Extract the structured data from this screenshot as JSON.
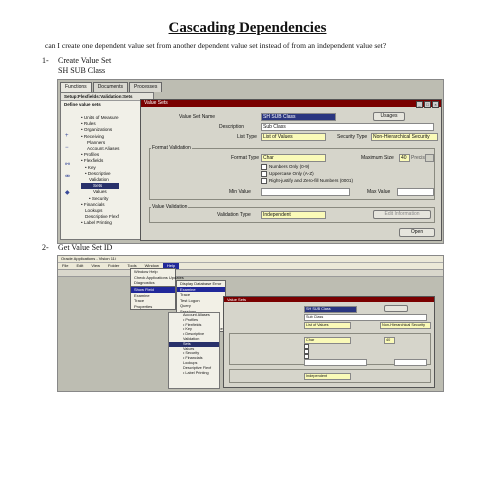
{
  "title": "Cascading Dependencies",
  "question": "can I create one dependent value set from another dependent value set instead of from an independent value set?",
  "step1": {
    "num": "1-",
    "line1": "Create Value Set",
    "line2": "SH SUB Class"
  },
  "step2": {
    "num": "2-",
    "text": "Get Value Set ID"
  },
  "screenshot1": {
    "tabs": [
      "Functions",
      "Documents",
      "Processes"
    ],
    "nav_header": "Setup:Flexfields:Validation:Sets",
    "nav_subheader": "Define value sets",
    "tree": [
      "• Units of Measure",
      "• Rules",
      "• Organizations",
      "• Receiving",
      "Planners",
      "Account Aliases",
      "• Profiles",
      "• Flexfields",
      "• Key",
      "• Descriptive",
      "Validation",
      "Sets",
      "Values",
      "• Security",
      "• Financials",
      "Lookups",
      "Descriptive Flexf",
      "• Label Printing"
    ],
    "window_title": "Value Sets",
    "value_set_name_label": "Value Set Name",
    "value_set_name": "SH SUB Class",
    "usages_button": "Usages",
    "description_label": "Description",
    "description": "Sub Class",
    "list_type_label": "List Type",
    "list_type": "List of Values",
    "security_type_label": "Security Type",
    "security_type": "Non-Hierarchical Security",
    "format_validation": "Format Validation",
    "format_type_label": "Format Type",
    "format_type": "Char",
    "maximum_size_label": "Maximum Size",
    "maximum_size": "40",
    "precision_label": "Precision",
    "checkboxes": [
      "Numbers Only (0-9)",
      "Uppercase Only (A-Z)",
      "Right-justify and Zero-fill Numbers (0001)"
    ],
    "min_value_label": "Min Value",
    "max_value_label": "Max Value",
    "value_validation": "Value Validation",
    "validation_type_label": "Validation Type",
    "validation_type": "Independent",
    "edit_information_button": "Edit Information",
    "open_button": "Open"
  },
  "screenshot2": {
    "app_title": "Oracle Applications - Vision 11i",
    "menu": [
      "File",
      "Edit",
      "View",
      "Folder",
      "Tools",
      "Window",
      "Help"
    ],
    "menu_left": [
      "Window Help",
      "Check Applications Updates",
      "Diagnostics"
    ],
    "diagnostics_menu": [
      "Show Field",
      "Examine",
      "Trace",
      "Properties"
    ],
    "examine_menu": [
      "Display Database Error",
      "Examine",
      "Trace",
      "Test Logon",
      "Query",
      "Sessions",
      "Properties",
      "Custom Code",
      "Check Available Services"
    ],
    "tree": [
      "Account Aliases",
      "• Profiles",
      "• Flexfields",
      "• Key",
      "• Descriptive",
      "Validation",
      "Sets",
      "Values",
      "• Security",
      "• Financials",
      "Lookups",
      "Descriptive Flexf",
      "• Label Printing"
    ],
    "window_title": "Value Sets",
    "value_set_name": "SH SUB Class",
    "description": "Sub Class",
    "list_type": "List of Values",
    "security_type": "Non-Hierarchical Security",
    "format_type": "Char",
    "maximum_size": "40",
    "validation_type": "Independent"
  }
}
